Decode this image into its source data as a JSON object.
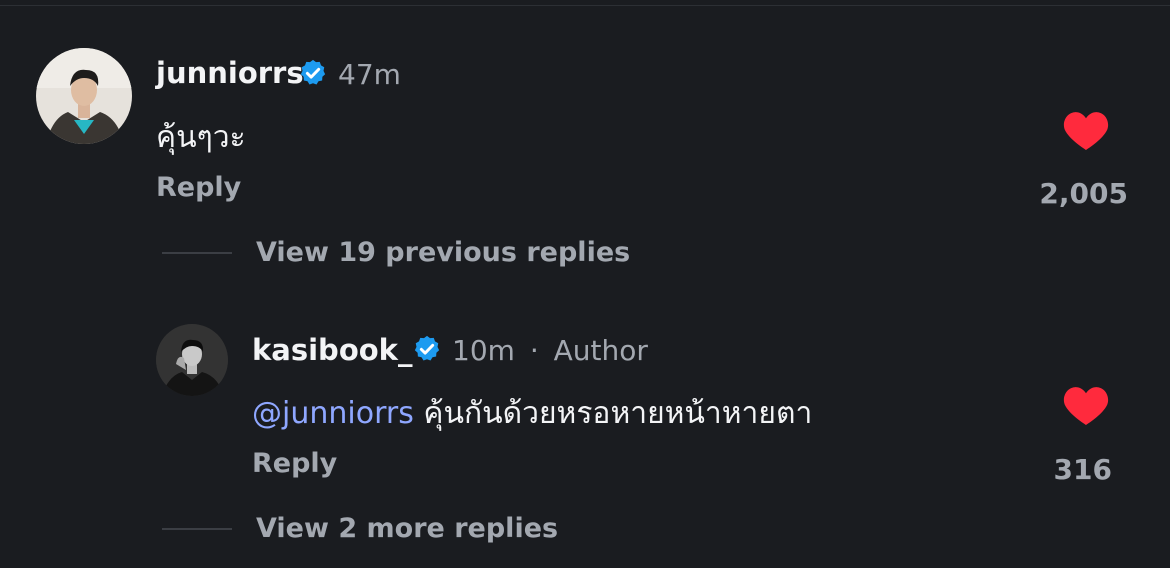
{
  "comment": {
    "username": "junniorrs",
    "time": "47m",
    "text": "คุ้นๆวะ",
    "reply_label": "Reply",
    "likes": "2,005",
    "view_previous_label": "View 19 previous replies"
  },
  "reply": {
    "username": "kasibook_",
    "time": "10m",
    "separator": "·",
    "author_label": "Author",
    "mention": "@junniorrs",
    "text": "คุ้นกันด้วยหรอหายหน้าหายตา",
    "reply_label": "Reply",
    "likes": "316",
    "view_more_label": "View 2 more replies"
  },
  "colors": {
    "background": "#1a1c20",
    "verified": "#1d9bf0",
    "heart": "#ff2a3d",
    "mention": "#8fa7ff",
    "muted": "#a3a8b0"
  },
  "icons": [
    "verified-icon",
    "heart-icon"
  ]
}
